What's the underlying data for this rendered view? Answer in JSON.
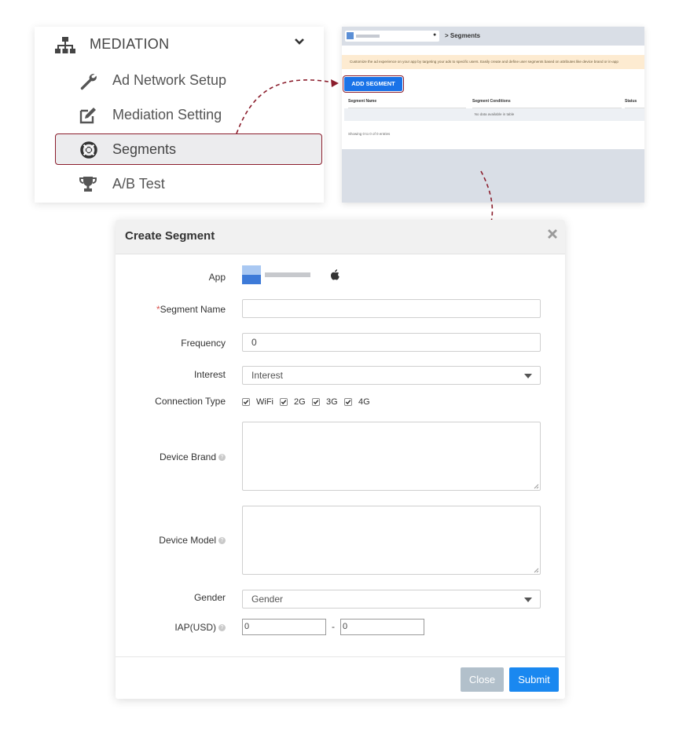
{
  "sidebar": {
    "section_title": "MEDIATION",
    "items": [
      {
        "label": "Ad Network Setup",
        "icon": "wrench-icon"
      },
      {
        "label": "Mediation Setting",
        "icon": "edit-icon"
      },
      {
        "label": "Segments",
        "icon": "lifebuoy-icon",
        "active": true
      },
      {
        "label": "A/B Test",
        "icon": "trophy-icon"
      }
    ]
  },
  "mini_screen": {
    "breadcrumb": "> Segments",
    "notice": "Customize the ad experience on your app by targeting your ads to specific users. Easily create and define user segments based on attributes like device brand or in-app",
    "add_button": "ADD SEGMENT",
    "columns": [
      "Segment Name",
      "Segment Conditions",
      "Status"
    ],
    "empty_text": "No data available in table",
    "footer_text": "Showing 0 to 0 of 0 entries"
  },
  "modal": {
    "title": "Create Segment",
    "fields": {
      "app_label": "App",
      "segment_name_required": "*",
      "segment_name_label": "Segment Name",
      "segment_name_value": "",
      "frequency_label": "Frequency",
      "frequency_value": "0",
      "interest_label": "Interest",
      "interest_selected": "Interest",
      "connection_label": "Connection Type",
      "connection_options": [
        "WiFi",
        "2G",
        "3G",
        "4G"
      ],
      "device_brand_label": "Device Brand",
      "device_model_label": "Device Model",
      "gender_label": "Gender",
      "gender_selected": "Gender",
      "iap_label": "IAP(USD)",
      "iap_min": "0",
      "iap_separator": "-",
      "iap_max": "0"
    },
    "buttons": {
      "close": "Close",
      "submit": "Submit"
    }
  },
  "colors": {
    "highlight": "#8b1d2c",
    "primary": "#1a88f0",
    "close_button": "#b2c0cb",
    "arrow": "#8b1d2c"
  }
}
